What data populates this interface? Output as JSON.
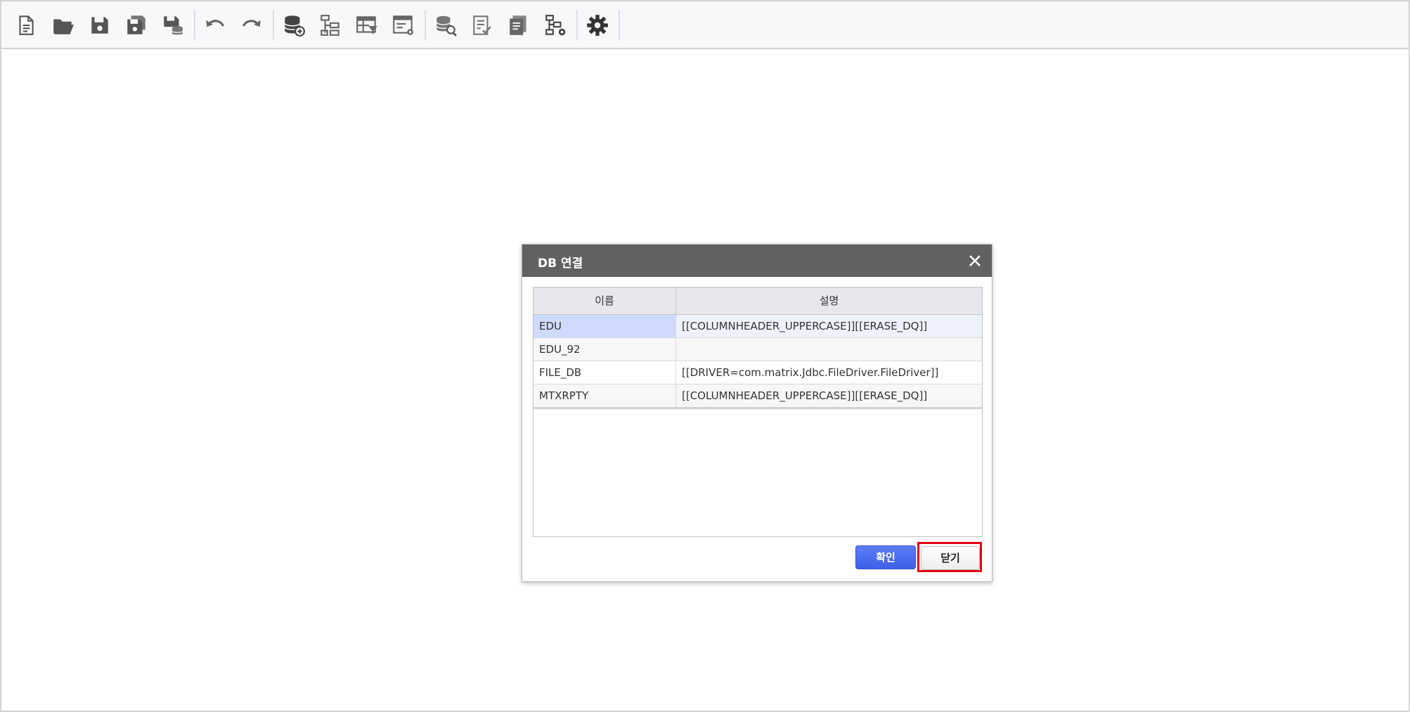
{
  "toolbar": {
    "buttons": [
      {
        "name": "new-document-icon"
      },
      {
        "name": "open-folder-icon"
      },
      {
        "name": "save-icon"
      },
      {
        "name": "save-as-icon"
      },
      {
        "name": "save-to-server-icon"
      },
      {
        "name": "undo-icon"
      },
      {
        "name": "redo-icon"
      },
      {
        "name": "db-connection-icon"
      },
      {
        "name": "data-tree-icon"
      },
      {
        "name": "table-filter-icon"
      },
      {
        "name": "form-settings-icon"
      },
      {
        "name": "db-query-icon"
      },
      {
        "name": "check-list-icon"
      },
      {
        "name": "report-icon"
      },
      {
        "name": "tree-settings-icon"
      },
      {
        "name": "gear-icon"
      }
    ]
  },
  "dialog": {
    "title": "DB 연결",
    "columns": {
      "name": "이름",
      "description": "설명"
    },
    "rows": [
      {
        "name": "EDU",
        "description": "[[COLUMNHEADER_UPPERCASE]][[ERASE_DQ]]",
        "selected": true
      },
      {
        "name": "EDU_92",
        "description": "",
        "selected": false
      },
      {
        "name": "FILE_DB",
        "description": "[[DRIVER=com.matrix.Jdbc.FileDriver.FileDriver]]",
        "selected": false
      },
      {
        "name": "MTXRPTY",
        "description": "[[COLUMNHEADER_UPPERCASE]][[ERASE_DQ]]",
        "selected": false
      }
    ],
    "ok_label": "확인",
    "close_label": "닫기"
  },
  "colors": {
    "title_bar": "#616163",
    "primary_button": "#4a6cf0",
    "selected_cell": "#cfdbfc",
    "highlight_border": "#e60012"
  }
}
